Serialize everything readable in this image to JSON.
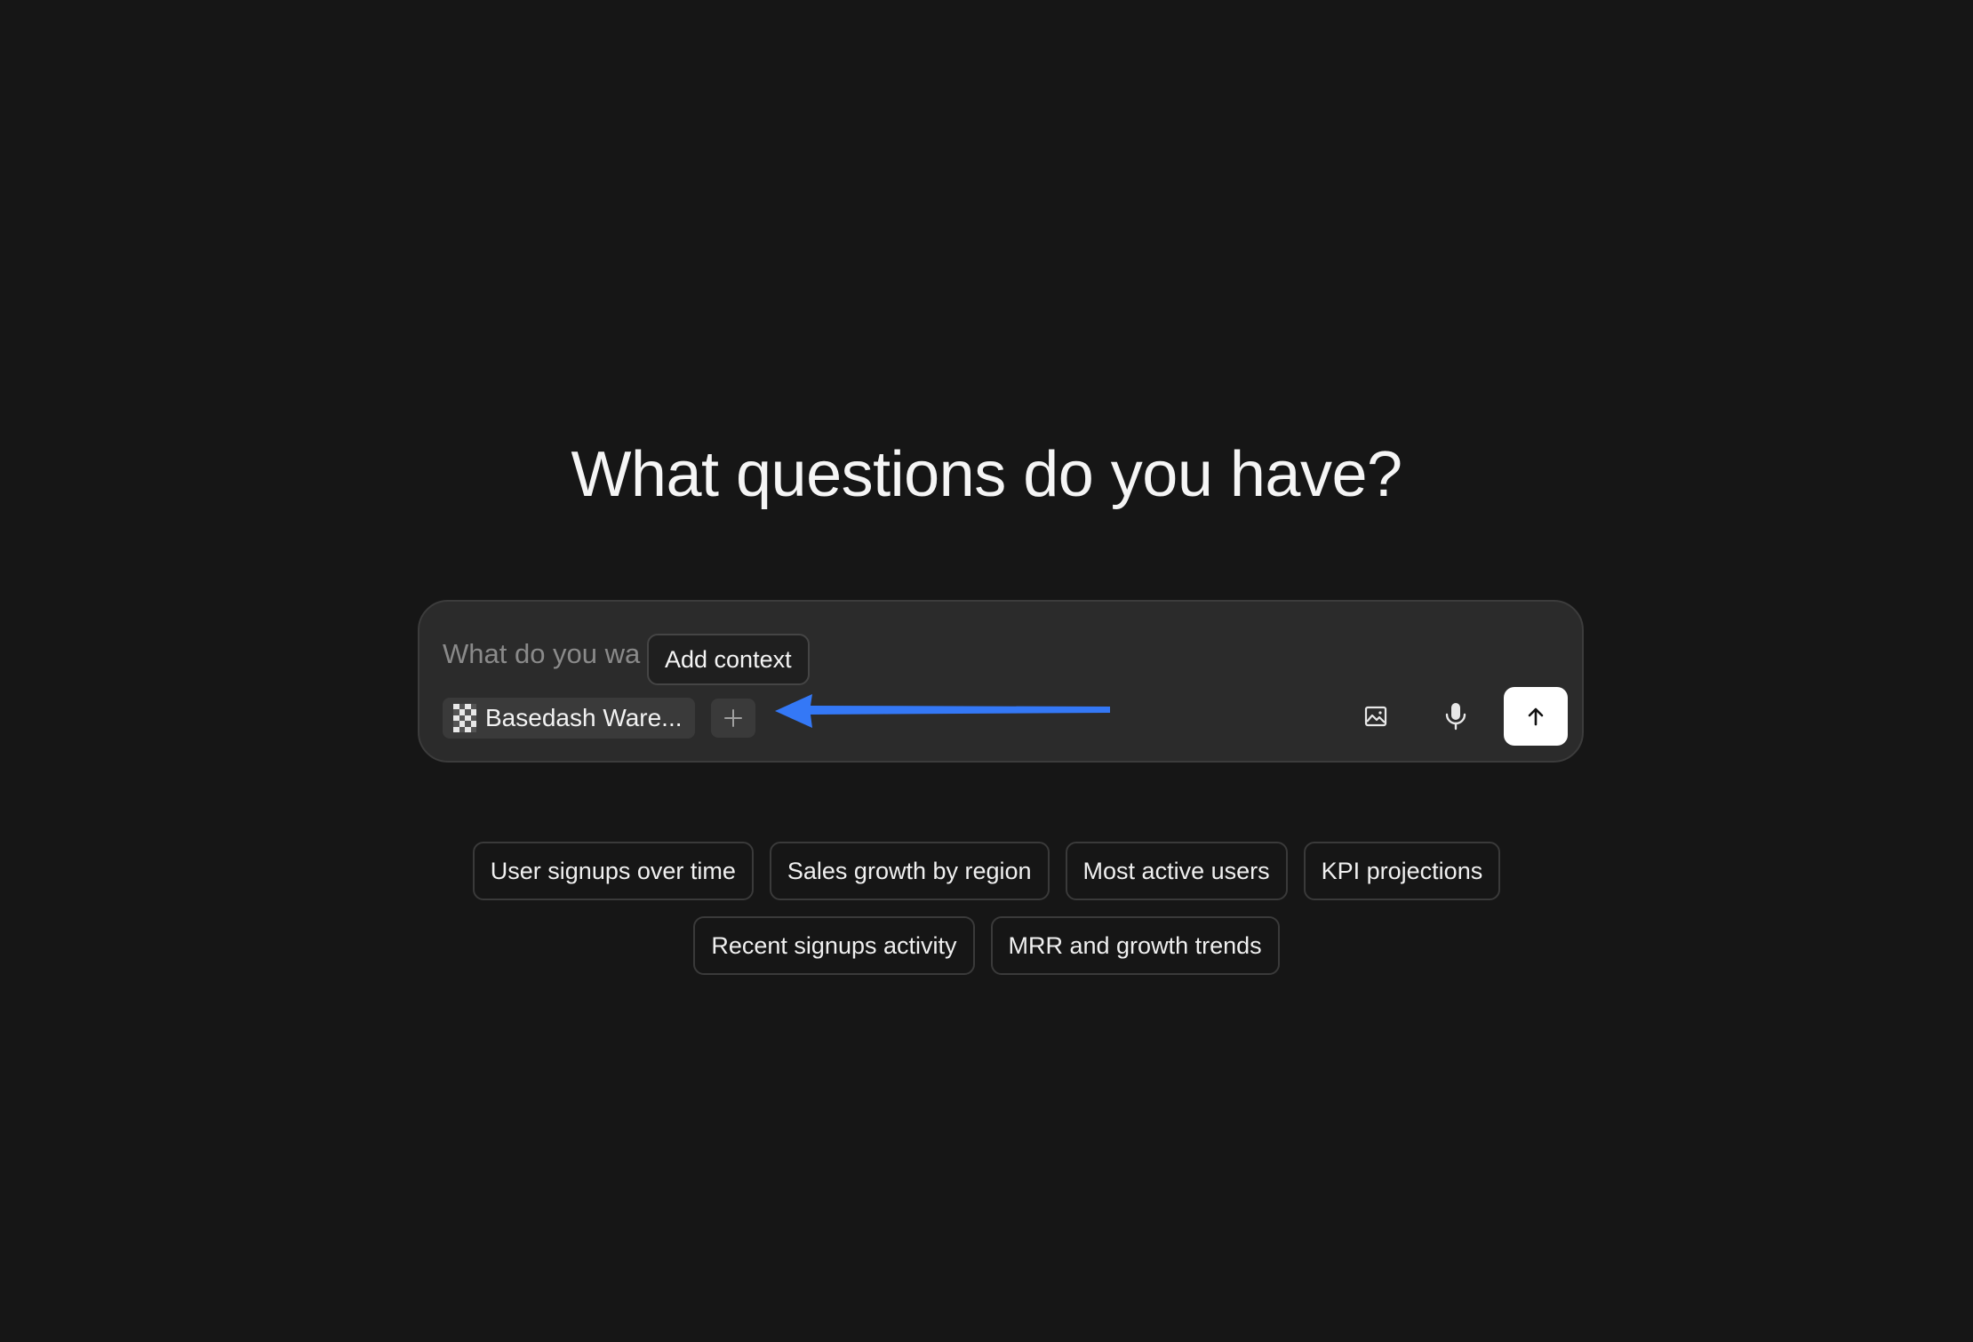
{
  "heading": "What questions do you have?",
  "composer": {
    "placeholder": "What do you wa",
    "context_chip": {
      "label": "Basedash Ware...",
      "icon": "checkerboard-database-icon"
    },
    "add_context_icon": "plus-icon",
    "tooltip": "Add context",
    "annotation_arrow_color": "#3478f6",
    "image_button_icon": "image-icon",
    "mic_button_icon": "microphone-icon",
    "send_button_icon": "arrow-up-icon"
  },
  "suggestions": {
    "row1": [
      "User signups over time",
      "Sales growth by region",
      "Most active users",
      "KPI projections"
    ],
    "row2": [
      "Recent signups activity",
      "MRR and growth trends"
    ]
  }
}
